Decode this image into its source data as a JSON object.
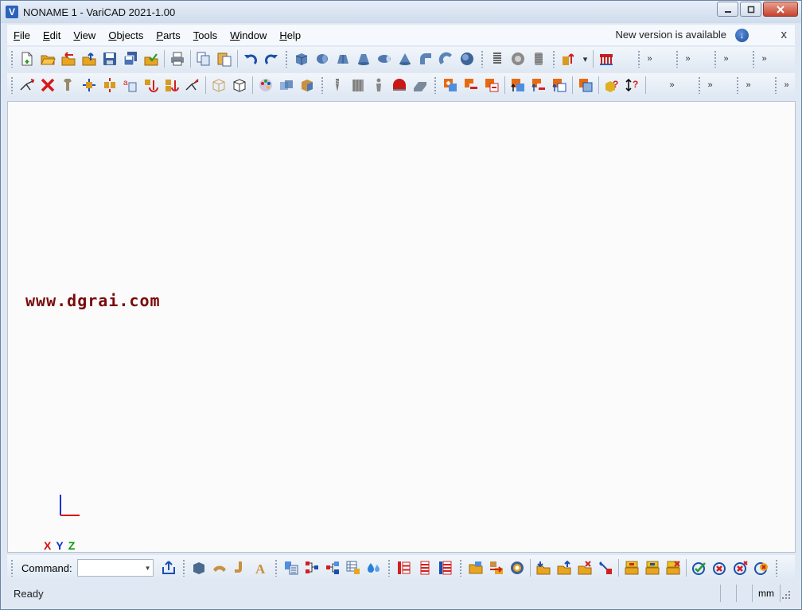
{
  "window": {
    "title": "NONAME 1 - VariCAD 2021-1.00",
    "logo_letter": "V",
    "controls": [
      "minimize",
      "maximize",
      "close"
    ]
  },
  "menubar": {
    "items": [
      {
        "label": "File",
        "accel": "F"
      },
      {
        "label": "Edit",
        "accel": "E"
      },
      {
        "label": "View",
        "accel": "V"
      },
      {
        "label": "Objects",
        "accel": "O"
      },
      {
        "label": "Parts",
        "accel": "P"
      },
      {
        "label": "Tools",
        "accel": "T"
      },
      {
        "label": "Window",
        "accel": "W"
      },
      {
        "label": "Help",
        "accel": "H"
      }
    ],
    "notice": "New version is available",
    "close_glyph": "x"
  },
  "toolbar1": {
    "icons": [
      "new-file-icon",
      "open-folder-icon",
      "open-recent-icon",
      "open-up-icon",
      "save-icon",
      "save-all-icon",
      "save-checked-icon",
      "print-icon",
      "copy-icon",
      "paste-icon",
      "undo-icon",
      "redo-icon",
      "box-icon",
      "cylinder-icon",
      "prism-icon",
      "cone-frustum-icon",
      "pipe-icon",
      "cone-icon",
      "elbow-icon",
      "torus-icon",
      "sphere-icon",
      "spring-icon",
      "thread-icon",
      "screw-icon",
      "extrude-icon",
      "bridge-icon"
    ]
  },
  "toolbar2": {
    "icons": [
      "transform-icon",
      "delete-icon",
      "move-icon",
      "scale-icon",
      "array-icon",
      "label-icon",
      "anchor-icon",
      "anchor-multi-icon",
      "rotate-icon",
      "wireframe-icon",
      "solid-view-icon",
      "palette-icon",
      "shade-icon",
      "render-icon",
      "drill-icon",
      "pattern-icon",
      "figure-icon",
      "fillet-icon",
      "chamfer-icon",
      "boolean-add-icon",
      "boolean-subtract-icon",
      "boolean-cut-icon",
      "assembly-add-icon",
      "assembly-insert-icon",
      "assembly-replace-icon",
      "select-window-icon",
      "query-icon",
      "measure-icon"
    ]
  },
  "canvas": {
    "watermark": "www.dgrai.com",
    "axis_labels": [
      "X",
      "Y",
      "Z"
    ]
  },
  "command_bar": {
    "label": "Command:",
    "value": "",
    "icons": [
      "export-icon",
      "solid-block-icon",
      "bent-pipe-icon",
      "sheet-bend-icon",
      "text-3d-icon",
      "bom-icon",
      "connect-icon",
      "split-icon",
      "table-icon",
      "water-drop-icon",
      "tree-icon",
      "list-icon",
      "list-alt-icon",
      "folder-open-icon",
      "folder-link-icon",
      "camera-icon",
      "import-icon",
      "export-up-icon",
      "remove-part-icon",
      "swap-icon",
      "group-add-icon",
      "group-edit-icon",
      "group-remove-icon",
      "check-ok-icon",
      "check-cancel-icon",
      "check-x-icon",
      "check-x2-icon"
    ]
  },
  "statusbar": {
    "text": "Ready",
    "unit": "mm"
  }
}
